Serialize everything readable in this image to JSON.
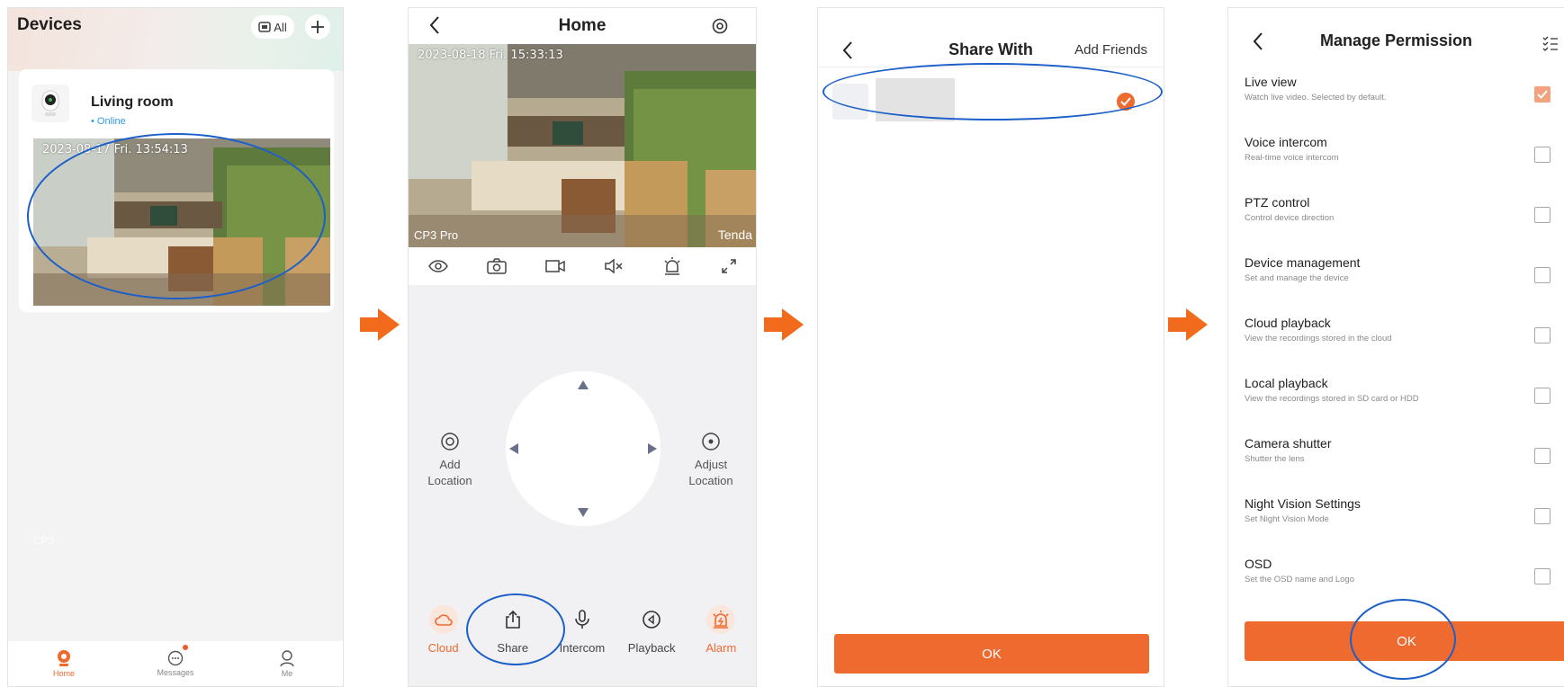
{
  "devices_screen": {
    "title": "Devices",
    "filter_label": "All",
    "device": {
      "name": "Living room",
      "status": "• Online",
      "timestamp": "2023-08-17 Fri. 13:54:13",
      "model_overlay": "CP3"
    },
    "tabs": [
      {
        "label": "Home",
        "icon": "home-icon"
      },
      {
        "label": "Messages",
        "icon": "chat-icon"
      },
      {
        "label": "Me",
        "icon": "user-icon"
      }
    ]
  },
  "home_screen": {
    "title": "Home",
    "timestamp": "2023-08-18 Fri. 15:33:13",
    "model_label": "CP3 Pro",
    "brand_label": "Tenda",
    "toolbar_icons": [
      "eye-icon",
      "snapshot-icon",
      "record-icon",
      "mute-icon",
      "alarm-touch-icon",
      "fullscreen-icon"
    ],
    "add_location": "Add\nLocation",
    "adjust_location": "Adjust\nLocation",
    "actions": [
      {
        "label": "Cloud",
        "icon": "cloud-icon"
      },
      {
        "label": "Share",
        "icon": "share-icon"
      },
      {
        "label": "Intercom",
        "icon": "microphone-icon"
      },
      {
        "label": "Playback",
        "icon": "playback-icon"
      },
      {
        "label": "Alarm",
        "icon": "alarm-icon"
      }
    ]
  },
  "share_screen": {
    "title": "Share With",
    "add_friends": "Add Friends",
    "ok": "OK"
  },
  "permission_screen": {
    "title": "Manage Permission",
    "items": [
      {
        "name": "Live view",
        "desc": "Watch live video. Selected by default.",
        "checked": true
      },
      {
        "name": "Voice intercom",
        "desc": "Real-time voice intercom",
        "checked": false
      },
      {
        "name": "PTZ control",
        "desc": "Control device direction",
        "checked": false
      },
      {
        "name": "Device management",
        "desc": "Set and manage the device",
        "checked": false
      },
      {
        "name": "Cloud playback",
        "desc": "View the recordings stored in the cloud",
        "checked": false
      },
      {
        "name": "Local playback",
        "desc": "View the recordings stored in SD card or HDD",
        "checked": false
      },
      {
        "name": "Camera shutter",
        "desc": "Shutter the lens",
        "checked": false
      },
      {
        "name": "Night Vision Settings",
        "desc": "Set Night Vision Mode",
        "checked": false
      },
      {
        "name": "OSD",
        "desc": "Set the OSD name and Logo",
        "checked": false
      }
    ],
    "ok": "OK"
  },
  "colors": {
    "accent": "#ef6a2e",
    "annotation": "#1c5fc9",
    "online": "#2e9be6"
  }
}
